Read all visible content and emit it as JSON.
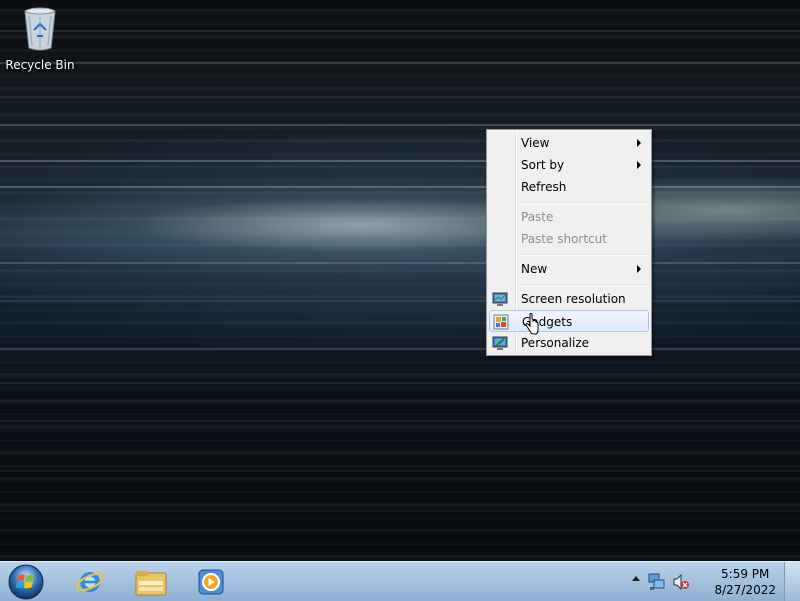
{
  "desktop": {
    "icons": [
      {
        "label": "Recycle Bin",
        "icon": "recycle-bin-icon"
      }
    ]
  },
  "context_menu": {
    "items": [
      {
        "label": "View",
        "submenu": true,
        "enabled": true
      },
      {
        "label": "Sort by",
        "submenu": true,
        "enabled": true
      },
      {
        "label": "Refresh",
        "submenu": false,
        "enabled": true
      },
      {
        "label": "Paste",
        "submenu": false,
        "enabled": false
      },
      {
        "label": "Paste shortcut",
        "submenu": false,
        "enabled": false
      },
      {
        "label": "New",
        "submenu": true,
        "enabled": true
      },
      {
        "label": "Screen resolution",
        "icon": "monitor-icon",
        "enabled": true
      },
      {
        "label": "Gadgets",
        "icon": "gadgets-icon",
        "enabled": true,
        "highlighted": true
      },
      {
        "label": "Personalize",
        "icon": "personalize-icon",
        "enabled": true
      }
    ]
  },
  "taskbar": {
    "start_icon": "windows-orb-icon",
    "pinned": [
      {
        "icon": "internet-explorer-icon"
      },
      {
        "icon": "file-explorer-icon"
      },
      {
        "icon": "media-player-icon"
      }
    ],
    "tray": {
      "icons": [
        "show-hidden-icons-arrow",
        "network-icon",
        "volume-muted-icon"
      ],
      "time": "5:59 PM",
      "date": "8/27/2022"
    }
  },
  "colors": {
    "taskbar": "#a6c2df",
    "menu_background": "#f0f0f0",
    "menu_highlight_border": "#a9c7ee",
    "disabled_text": "#8d8d8d"
  }
}
